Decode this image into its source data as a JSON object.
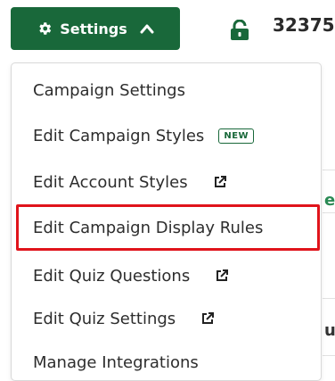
{
  "toolbar": {
    "settings_label": "Settings",
    "campaign_id": "32375",
    "icons": {
      "settings": "gear-icon",
      "toggle": "chevron-up-icon",
      "lock": "lock-icon"
    }
  },
  "background_fragments": [
    "e",
    "u"
  ],
  "menu": {
    "items": [
      {
        "label": "Campaign Settings"
      },
      {
        "label": "Edit Campaign Styles",
        "badge": "NEW"
      },
      {
        "label": "Edit Account Styles",
        "icon": "external-link-icon"
      },
      {
        "label": "Edit Campaign Display Rules",
        "highlighted": true
      },
      {
        "label": "Edit Quiz Questions",
        "icon": "external-link-icon"
      },
      {
        "label": "Edit Quiz Settings",
        "icon": "external-link-icon"
      },
      {
        "label": "Manage Integrations"
      }
    ]
  },
  "colors": {
    "brand_green": "#19683a",
    "highlight_red": "#e0141b",
    "text": "#2d2d2d"
  }
}
